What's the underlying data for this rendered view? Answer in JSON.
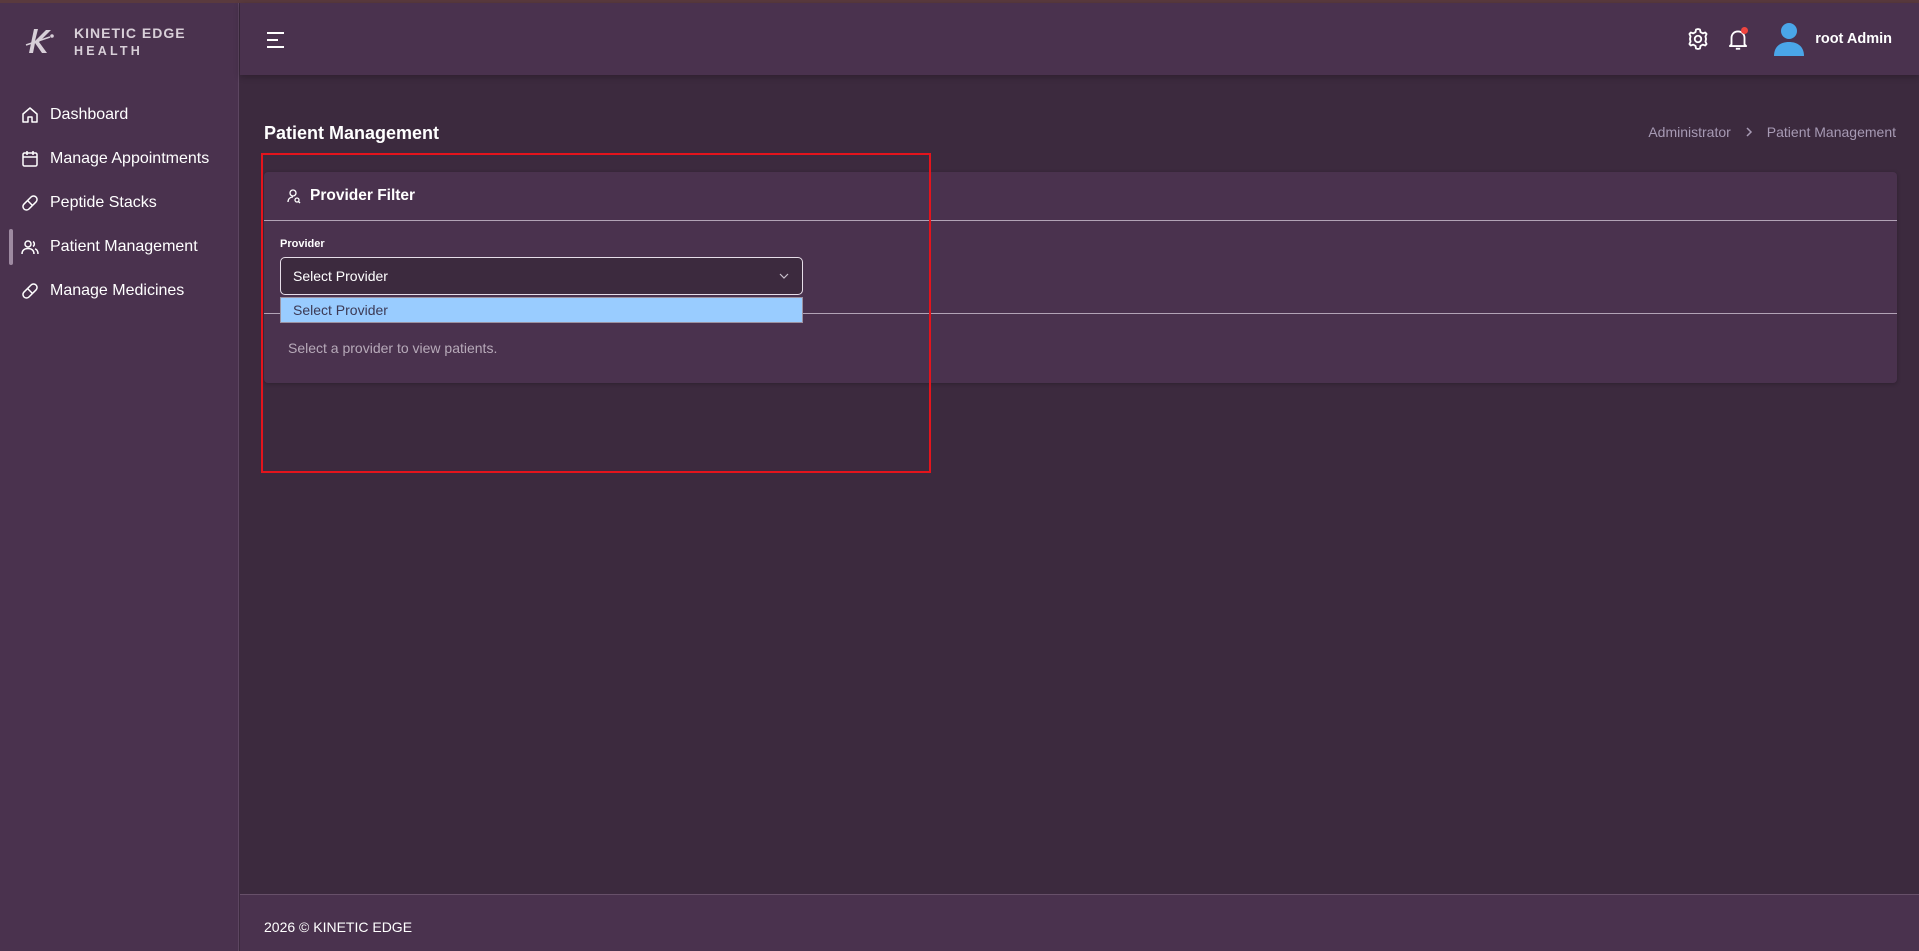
{
  "brand": {
    "line1": "KINETIC EDGE",
    "line2": "HEALTH"
  },
  "sidebar": {
    "items": [
      {
        "label": "Dashboard",
        "icon": "home-icon"
      },
      {
        "label": "Manage Appointments",
        "icon": "calendar-icon"
      },
      {
        "label": "Peptide Stacks",
        "icon": "pill-icon"
      },
      {
        "label": "Patient Management",
        "icon": "users-icon",
        "active": true
      },
      {
        "label": "Manage Medicines",
        "icon": "pill-icon"
      }
    ]
  },
  "header": {
    "menu_icon": "hamburger-icon",
    "settings_icon": "gear-icon",
    "notifications_icon": "bell-icon",
    "user_name": "root Admin"
  },
  "page": {
    "title": "Patient Management",
    "breadcrumb": [
      "Administrator",
      "Patient Management"
    ]
  },
  "provider_filter": {
    "title": "Provider Filter",
    "field_label": "Provider",
    "selected": "Select Provider",
    "options": [
      "Select Provider"
    ],
    "empty_message": "Select a provider to view patients."
  },
  "footer": {
    "text": "2026 © KINETIC EDGE"
  },
  "colors": {
    "background": "#3c2a3e",
    "surface": "#4a324e",
    "highlight": "#e4141c",
    "option_selected": "#99ccff",
    "notification_dot": "#f0453f",
    "avatar": "#4aa6e8"
  }
}
